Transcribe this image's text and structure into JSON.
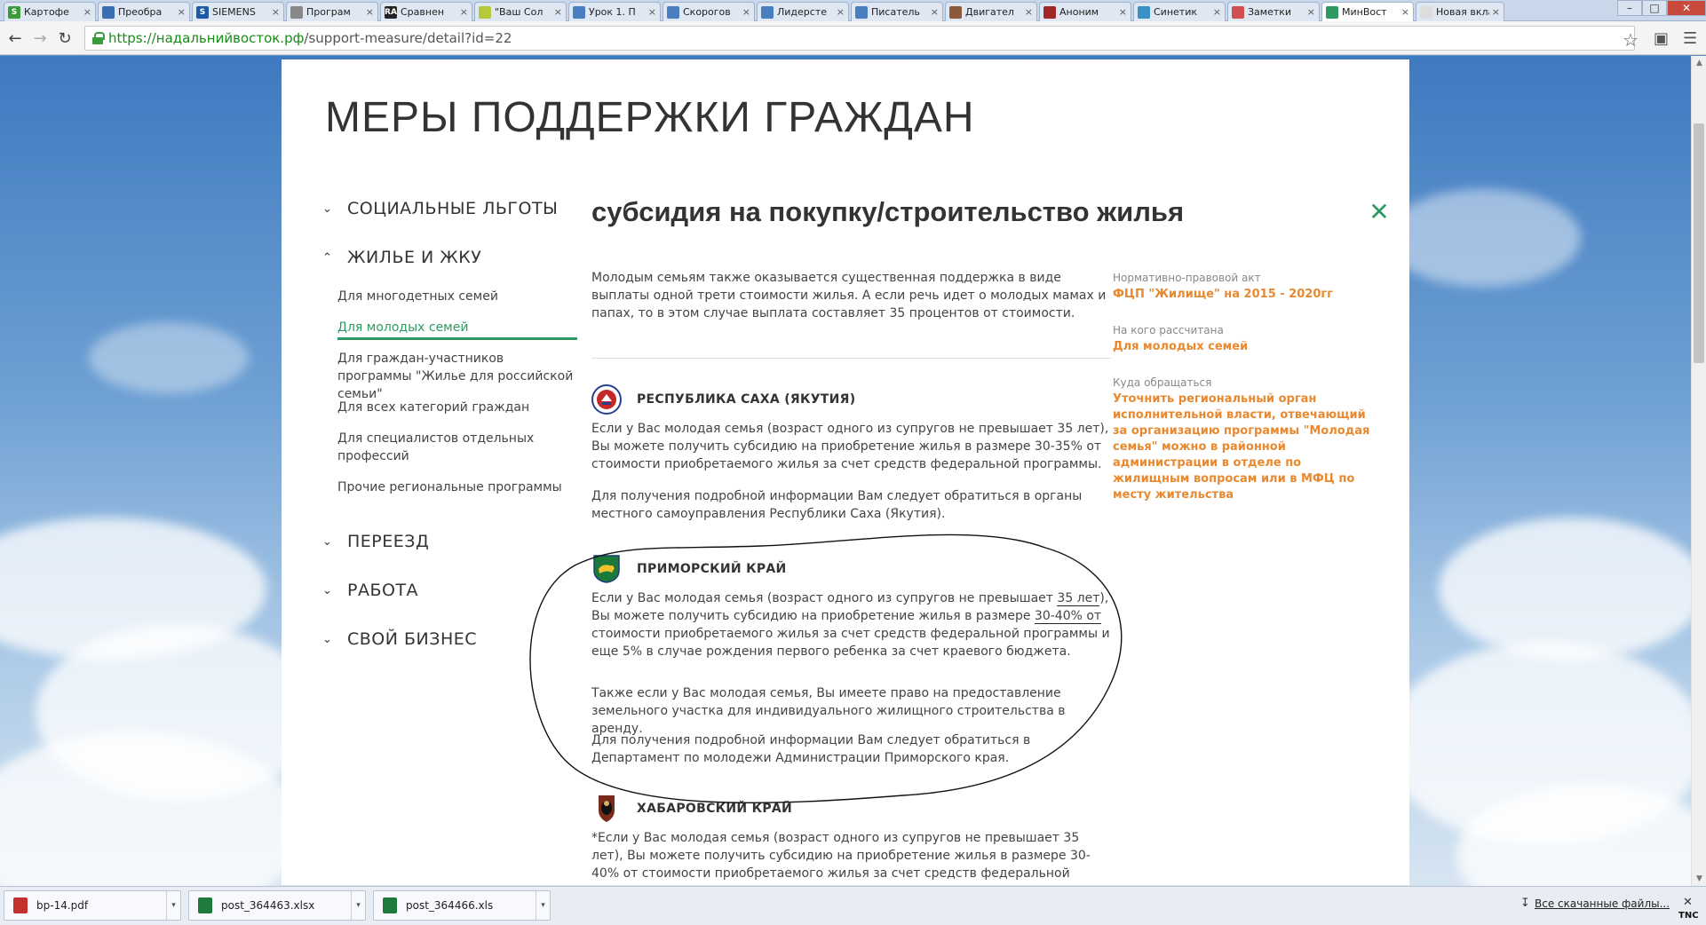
{
  "browser": {
    "tabs": [
      {
        "label": "Картофе",
        "color": "#3b9a3b",
        "glyph": "S"
      },
      {
        "label": "Преобра",
        "color": "#3a6fb5",
        "glyph": ""
      },
      {
        "label": "SIEMENS",
        "color": "#1d5aa8",
        "glyph": "S"
      },
      {
        "label": "Програм",
        "color": "#888888",
        "glyph": ""
      },
      {
        "label": "Сравнен",
        "color": "#222222",
        "glyph": "RA"
      },
      {
        "label": "\"Ваш Сол",
        "color": "#b5c93b",
        "glyph": ""
      },
      {
        "label": "Урок 1. П",
        "color": "#4a7fbf",
        "glyph": ""
      },
      {
        "label": "Скорогов",
        "color": "#4a7fbf",
        "glyph": ""
      },
      {
        "label": "Лидерсте",
        "color": "#4a7fbf",
        "glyph": ""
      },
      {
        "label": "Писатель",
        "color": "#4a7fbf",
        "glyph": ""
      },
      {
        "label": "Двигател",
        "color": "#8a5a3a",
        "glyph": ""
      },
      {
        "label": "Аноним",
        "color": "#a02828",
        "glyph": ""
      },
      {
        "label": "Синетик",
        "color": "#3a8fc4",
        "glyph": ""
      },
      {
        "label": "Заметки",
        "color": "#d05050",
        "glyph": ""
      },
      {
        "label": "МинВост",
        "color": "#2d9a64",
        "glyph": ""
      },
      {
        "label": "Новая вкла",
        "color": "#dddddd",
        "glyph": ""
      }
    ],
    "url_host": "https://надальнийвосток.рф",
    "url_path": "/support-measure/detail?id=22"
  },
  "page": {
    "title": "МЕРЫ ПОДДЕРЖКИ ГРАЖДАН",
    "nav": {
      "sections": [
        {
          "label": "СОЦИАЛЬНЫЕ ЛЬГОТЫ",
          "chevron": "down"
        },
        {
          "label": "ЖИЛЬЕ И ЖКУ",
          "chevron": "up"
        },
        {
          "label": "ПЕРЕЕЗД",
          "chevron": "down"
        },
        {
          "label": "РАБОТА",
          "chevron": "down"
        },
        {
          "label": "СВОЙ БИЗНЕС",
          "chevron": "down"
        }
      ],
      "housing_items": [
        "Для многодетных семей",
        "Для молодых семей",
        "Для граждан-участников программы \"Жилье для российской семьи\"",
        "Для всех категорий граждан",
        "Для специалистов отдельных профессий",
        "Прочие региональные программы"
      ]
    },
    "detail": {
      "title": "субсидия на покупку/строительство жилья",
      "intro": "Молодым семьям также оказывается существенная поддержка в виде выплаты одной трети стоимости жилья. А если речь идет о молодых мамах и папах, то в этом случае выплата составляет 35 процентов от стоимости.",
      "regions": [
        {
          "name": "РЕСПУБЛИКА САХА (ЯКУТИЯ)",
          "p1": "Если у Вас молодая семья (возраст одного из супругов не превышает 35 лет), Вы можете получить субсидию на приобретение жилья в размере 30-35% от стоимости приобретаемого жилья за счет средств федеральной программы.",
          "p2": "Для получения подробной информации Вам следует обратиться в органы местного самоуправления Республики Саха (Якутия)."
        },
        {
          "name": "ПРИМОРСКИЙ КРАЙ",
          "p1_a": "Если у Вас молодая семья (возраст одного из супругов не превышает ",
          "p1_b": "35 лет",
          "p1_c": "), Вы можете получить субсидию на приобретение жилья в размере ",
          "p1_d": "30-40% от",
          "p1_e": " стоимости приобретаемого жилья за счет средств федеральной программы и еще 5% в случае рождения первого ребенка за счет краевого бюджета.",
          "p2": "Также если у Вас молодая семья, Вы имеете право на предоставление земельного участка для индивидуального жилищного строительства в аренду.",
          "p3": "Для получения подробной информации Вам следует обратиться в Департамент по молодежи Администрации Приморского края."
        },
        {
          "name": "ХАБАРОВСКИЙ КРАЙ",
          "p1": "*Если у Вас молодая семья (возраст одного из супругов не превышает 35 лет), Вы можете получить субсидию на приобретение жилья в размере 30-40% от стоимости приобретаемого жилья за счет средств федеральной программы."
        }
      ],
      "meta": {
        "act_label": "Нормативно-правовой акт",
        "act_value": "ФЦП \"Жилище\" на 2015 - 2020гг",
        "target_label": "На кого рассчитана",
        "target_value": "Для молодых семей",
        "contact_label": "Куда обращаться",
        "contact_value": "Уточнить региональный орган исполнительной власти, отвечающий за организацию программы \"Молодая семья\" можно в районной администрации в отделе по жилищным вопросам или в МФЦ по месту жительства"
      }
    }
  },
  "downloads": {
    "items": [
      {
        "name": "bp-14.pdf",
        "color": "#c4302b"
      },
      {
        "name": "post_364463.xlsx",
        "color": "#1f7a3f"
      },
      {
        "name": "post_364466.xls",
        "color": "#1f7a3f"
      }
    ],
    "show_all": "Все скачанные файлы...",
    "watermark": "TNC"
  },
  "colors": {
    "accent": "#2d9a64",
    "link_orange": "#e8892f"
  }
}
